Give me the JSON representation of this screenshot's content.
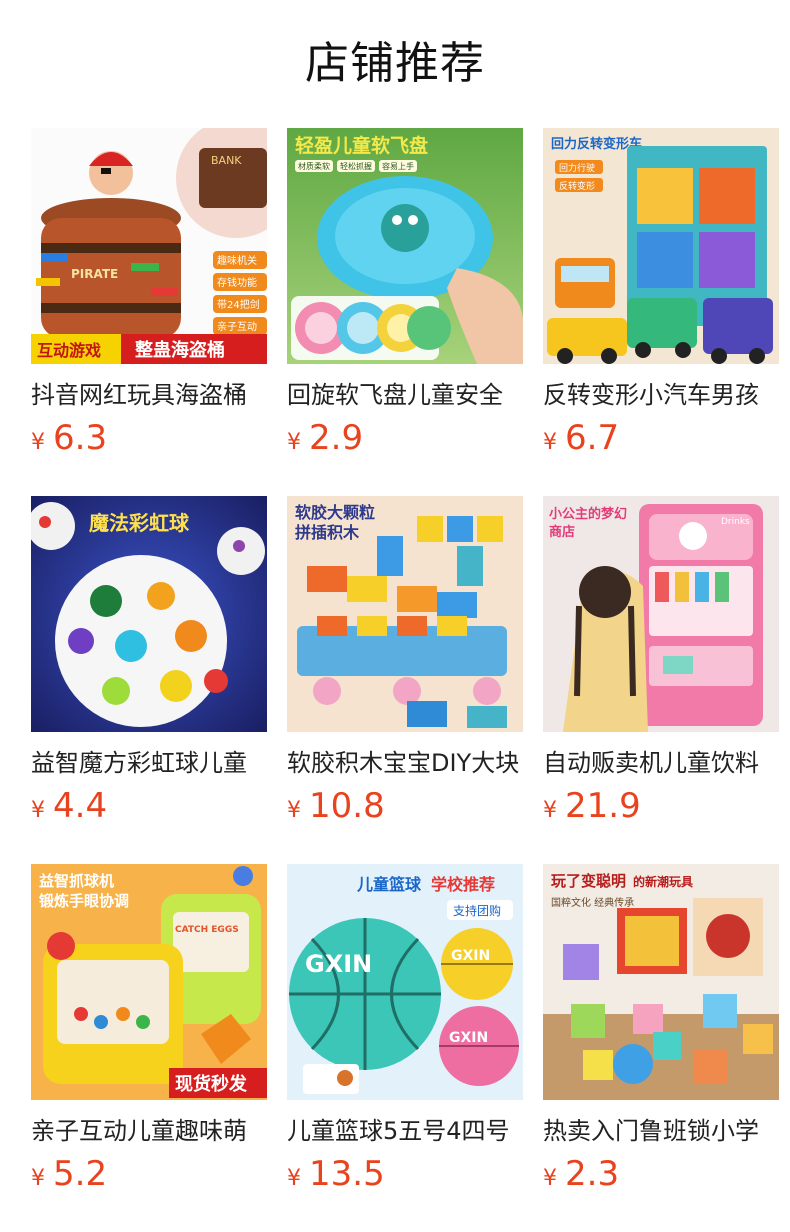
{
  "section": {
    "title": "店铺推荐"
  },
  "products": [
    {
      "name": "抖音网红玩具海盗桶",
      "currency": "¥",
      "price": "6.3",
      "image": {
        "icon": "pirate-barrel-toy",
        "badge_left": "互动游戏",
        "badge_right": "整蛊海盗桶",
        "features": [
          "趣味机关",
          "存钱功能",
          "带24把剑",
          "亲子互动"
        ],
        "bank_label": "BANK",
        "barrel_text": "PIRATE"
      }
    },
    {
      "name": "回旋软飞盘儿童安全",
      "currency": "¥",
      "price": "2.9",
      "image": {
        "icon": "frisbee-toy",
        "headline": "轻盈儿童软飞盘",
        "tags": [
          "材质柔软",
          "轻松抓握",
          "容易上手"
        ]
      }
    },
    {
      "name": "反转变形小汽车男孩",
      "currency": "¥",
      "price": "6.7",
      "image": {
        "icon": "transforming-car-toy",
        "headline": "回力反转变形车",
        "tags": [
          "回力行驶",
          "反转变形"
        ]
      }
    },
    {
      "name": "益智魔方彩虹球儿童",
      "currency": "¥",
      "price": "4.4",
      "image": {
        "icon": "rainbow-ball-toy",
        "headline": "魔法彩虹球"
      }
    },
    {
      "name": "软胶积木宝宝DIY大块",
      "currency": "¥",
      "price": "10.8",
      "image": {
        "icon": "building-blocks-toy",
        "headline_line1": "软胶大颗粒",
        "headline_line2": "拼插积木"
      }
    },
    {
      "name": "自动贩卖机儿童饮料",
      "currency": "¥",
      "price": "21.9",
      "image": {
        "icon": "vending-machine-toy",
        "headline_line1": "小公主的梦幻",
        "headline_line2": "商店",
        "sign": "Drinks"
      }
    },
    {
      "name": "亲子互动儿童趣味萌",
      "currency": "¥",
      "price": "5.2",
      "image": {
        "icon": "claw-ball-game-toy",
        "headline_line1": "益智抓球机",
        "headline_line2": "锻炼手眼协调",
        "badge": "现货秒发",
        "panel_text": "CATCH EGGS"
      }
    },
    {
      "name": "儿童篮球5五号4四号",
      "currency": "¥",
      "price": "13.5",
      "image": {
        "icon": "basketball",
        "headline_a": "儿童篮球",
        "headline_b": "学校推荐",
        "tag": "支持团购",
        "brand": "GXIN"
      }
    },
    {
      "name": "热卖入门鲁班锁小学",
      "currency": "¥",
      "price": "2.3",
      "image": {
        "icon": "luban-lock-puzzle",
        "headline_a": "玩了变聪明",
        "headline_b": "的新潮玩具",
        "sub": "国粹文化 经典传承"
      }
    }
  ]
}
